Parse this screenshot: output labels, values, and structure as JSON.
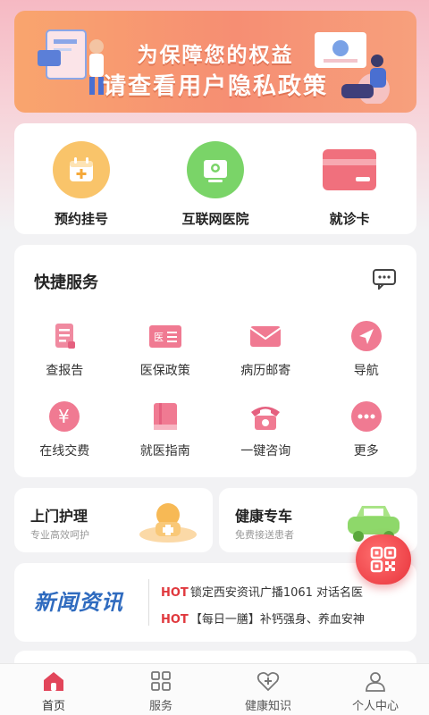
{
  "banner": {
    "line1": "为保障您的权益",
    "line2": "请查看用户隐私政策"
  },
  "main_services": [
    {
      "label": "预约挂号",
      "icon": "calendar-add-icon",
      "color": "#f7b24a"
    },
    {
      "label": "互联网医院",
      "icon": "monitor-icon",
      "color": "#6fcf5a"
    },
    {
      "label": "就诊卡",
      "icon": "card-icon",
      "color": "#f0707d"
    }
  ],
  "quick_services": {
    "title": "快捷服务",
    "items": [
      {
        "label": "查报告",
        "icon": "report-icon"
      },
      {
        "label": "医保政策",
        "icon": "insurance-card-icon"
      },
      {
        "label": "病历邮寄",
        "icon": "mail-icon"
      },
      {
        "label": "导航",
        "icon": "navigation-icon"
      },
      {
        "label": "在线交费",
        "icon": "yen-payment-icon"
      },
      {
        "label": "就医指南",
        "icon": "guide-book-icon"
      },
      {
        "label": "一键咨询",
        "icon": "telephone-icon"
      },
      {
        "label": "更多",
        "icon": "more-icon"
      }
    ]
  },
  "cards": {
    "home_care": {
      "title": "上门护理",
      "subtitle": "专业高效呵护"
    },
    "health_car": {
      "title": "健康专车",
      "subtitle": "免费接送患者"
    }
  },
  "news": {
    "logo": "新闻资讯",
    "items": [
      {
        "hot": "HOT",
        "text": "锁定西安资讯广播1061 对话名医"
      },
      {
        "hot": "HOT",
        "text": "【每日一膳】补钙强身、养血安神"
      }
    ]
  },
  "tabs": [
    {
      "label": "首页",
      "icon": "home-icon",
      "active": true
    },
    {
      "label": "服务",
      "icon": "grid-icon",
      "active": false
    },
    {
      "label": "健康知识",
      "icon": "heart-plus-icon",
      "active": false
    },
    {
      "label": "个人中心",
      "icon": "user-icon",
      "active": false
    }
  ],
  "colors": {
    "accent": "#f0707d",
    "hot": "#e0393e",
    "news_logo": "#2f6bbf"
  }
}
